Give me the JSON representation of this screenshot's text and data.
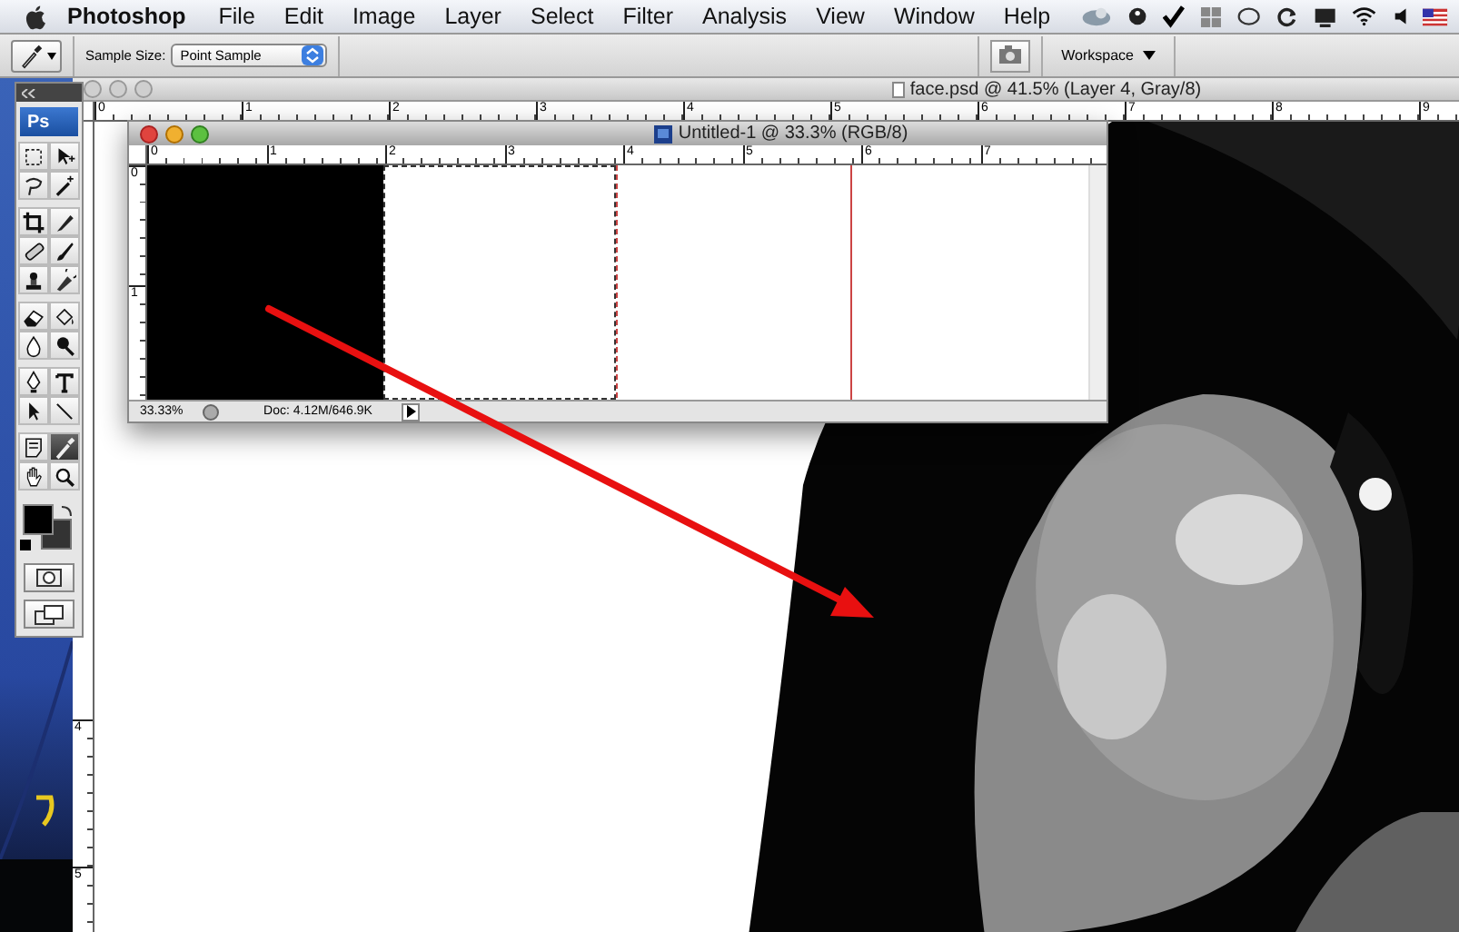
{
  "menu_bar": {
    "app": "Photoshop",
    "items": [
      "File",
      "Edit",
      "Image",
      "Layer",
      "Select",
      "Filter",
      "Analysis",
      "View",
      "Window",
      "Help"
    ]
  },
  "options_bar": {
    "sample_size_label": "Sample Size:",
    "sample_size": "Point Sample",
    "workspace": "Workspace"
  },
  "toolbox": {
    "logo": "Ps",
    "tools": [
      {
        "kind": "marquee",
        "selected": false
      },
      {
        "kind": "move",
        "selected": false
      },
      {
        "kind": "lasso",
        "selected": false
      },
      {
        "kind": "wand",
        "selected": false
      },
      {
        "kind": "crop",
        "selected": false
      },
      {
        "kind": "slice",
        "selected": false
      },
      {
        "kind": "heal",
        "selected": false
      },
      {
        "kind": "brush",
        "selected": false
      },
      {
        "kind": "stamp",
        "selected": false
      },
      {
        "kind": "history",
        "selected": false
      },
      {
        "kind": "eraser",
        "selected": false
      },
      {
        "kind": "bucket",
        "selected": false
      },
      {
        "kind": "blur",
        "selected": false
      },
      {
        "kind": "dodge",
        "selected": false
      },
      {
        "kind": "pen",
        "selected": false
      },
      {
        "kind": "type",
        "selected": false
      },
      {
        "kind": "arrow",
        "selected": false
      },
      {
        "kind": "line",
        "selected": false
      },
      {
        "kind": "notes",
        "selected": false
      },
      {
        "kind": "eyedropper",
        "selected": true
      },
      {
        "kind": "hand",
        "selected": false
      },
      {
        "kind": "zoom",
        "selected": false
      }
    ]
  },
  "document": {
    "title": "face.psd @ 41.5% (Layer 4, Gray/8)",
    "ruler_marks": [
      "0",
      "1",
      "2",
      "3",
      "4",
      "5",
      "6",
      "7",
      "8",
      "9"
    ],
    "side_ruler_marks": [
      "4",
      "5"
    ]
  },
  "floating_document": {
    "title": "Untitled-1 @ 33.3% (RGB/8)",
    "ruler_marks": [
      "0",
      "1",
      "2",
      "3",
      "4",
      "5",
      "6",
      "7"
    ],
    "side_ruler_marks": [
      "0",
      "1"
    ],
    "zoom": "33.33%",
    "doc_size": "Doc: 4.12M/646.9K"
  }
}
